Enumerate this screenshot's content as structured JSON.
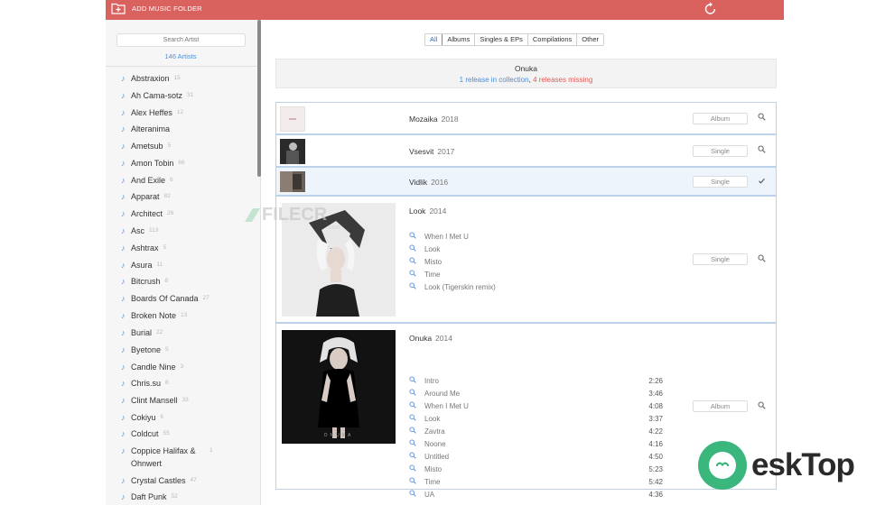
{
  "topbar": {
    "add_label": "ADD MUSIC FOLDER"
  },
  "sidebar": {
    "search_placeholder": "Search Artist",
    "count": "146 Artists",
    "artists": [
      {
        "name": "Abstraxion",
        "count": "15"
      },
      {
        "name": "Ah Cama-sotz",
        "count": "31"
      },
      {
        "name": "Alex Heffes",
        "count": "12"
      },
      {
        "name": "Alteranima",
        "count": ""
      },
      {
        "name": "Ametsub",
        "count": "5"
      },
      {
        "name": "Amon Tobin",
        "count": "66"
      },
      {
        "name": "And Exile",
        "count": "6"
      },
      {
        "name": "Apparat",
        "count": "82"
      },
      {
        "name": "Architect",
        "count": "26"
      },
      {
        "name": "Asc",
        "count": "113"
      },
      {
        "name": "Ashtrax",
        "count": "5"
      },
      {
        "name": "Asura",
        "count": "11"
      },
      {
        "name": "Bitcrush",
        "count": "8"
      },
      {
        "name": "Boards Of Canada",
        "count": "27"
      },
      {
        "name": "Broken Note",
        "count": "13"
      },
      {
        "name": "Burial",
        "count": "22"
      },
      {
        "name": "Byetone",
        "count": "5"
      },
      {
        "name": "Candle Nine",
        "count": "3"
      },
      {
        "name": "Chris.su",
        "count": "8"
      },
      {
        "name": "Clint Mansell",
        "count": "33"
      },
      {
        "name": "Cokiyu",
        "count": "6"
      },
      {
        "name": "Coldcut",
        "count": "55"
      },
      {
        "name": "Coppice Halifax & Ohnwert",
        "count": "1"
      },
      {
        "name": "Crystal Castles",
        "count": "47"
      },
      {
        "name": "Daft Punk",
        "count": "52"
      }
    ]
  },
  "main": {
    "tabs": [
      {
        "label": "All",
        "active": true
      },
      {
        "label": "Albums",
        "active": false
      },
      {
        "label": "Singles & EPs",
        "active": false
      },
      {
        "label": "Compilations",
        "active": false
      },
      {
        "label": "Other",
        "active": false
      }
    ],
    "artist": {
      "name": "Onuka",
      "in_collection": "1 release in collection",
      "missing": "4 releases missing"
    },
    "releases": [
      {
        "title": "Mozaika",
        "year": "2018",
        "type": "Album",
        "action_icon": "search-icon"
      },
      {
        "title": "Vsesvit",
        "year": "2017",
        "type": "Single",
        "action_icon": "search-icon"
      },
      {
        "title": "Vidlik",
        "year": "2016",
        "type": "Single",
        "action_icon": "checkmark-icon",
        "selected": true
      },
      {
        "title": "Look",
        "year": "2014",
        "type": "Single",
        "action_icon": "search-icon",
        "tracks": [
          {
            "name": "When I Met U"
          },
          {
            "name": "Look"
          },
          {
            "name": "Misto"
          },
          {
            "name": "Time"
          },
          {
            "name": "Look (Tigerskin remix)"
          }
        ]
      },
      {
        "title": "Onuka",
        "year": "2014",
        "type": "Album",
        "action_icon": "search-icon",
        "cover_text": "ONUKA",
        "tracks": [
          {
            "name": "Intro",
            "duration": "2:26"
          },
          {
            "name": "Around Me",
            "duration": "3:46"
          },
          {
            "name": "When I Met U",
            "duration": "4:08"
          },
          {
            "name": "Look",
            "duration": "3:37"
          },
          {
            "name": "Zavtra",
            "duration": "4:22"
          },
          {
            "name": "Noone",
            "duration": "4:16"
          },
          {
            "name": "Untitled",
            "duration": "4:50"
          },
          {
            "name": "Misto",
            "duration": "5:23"
          },
          {
            "name": "Time",
            "duration": "5:42"
          },
          {
            "name": "UA",
            "duration": "4:36"
          }
        ]
      }
    ]
  },
  "watermarks": {
    "filecr": "FILECR",
    "filecr_sub": ".com",
    "brand": "eskTop"
  },
  "colors": {
    "accent": "#d9625f",
    "link": "#4c8ed8",
    "missing": "#e25b55"
  }
}
